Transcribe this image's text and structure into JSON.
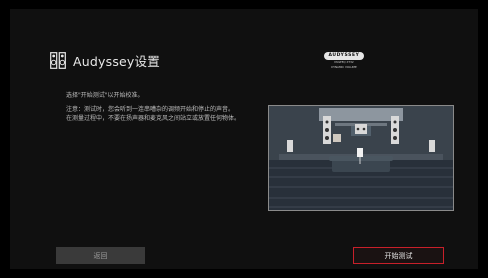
{
  "header": {
    "title": "Audyssey设置",
    "icon": "speakers-icon"
  },
  "logo": {
    "brand": "AUDYSSEY",
    "sub1": "MULTEQ XT32",
    "sub2": "DYNAMIC VOLUME"
  },
  "instructions": {
    "line1": "选择\"开始测试\"以开始校准。",
    "line2": "注意：测试时，您会听到一连串嘈杂的调频开始和停止的声音。",
    "line3": "在测量过程中，不要在扬声器和麦克风之间站立或放置任何物体。"
  },
  "illustration": {
    "name": "living-room-illustration"
  },
  "buttons": {
    "back": "返回",
    "start": "开始测试"
  },
  "colors": {
    "accent": "#c8202a",
    "background": "#101010"
  }
}
